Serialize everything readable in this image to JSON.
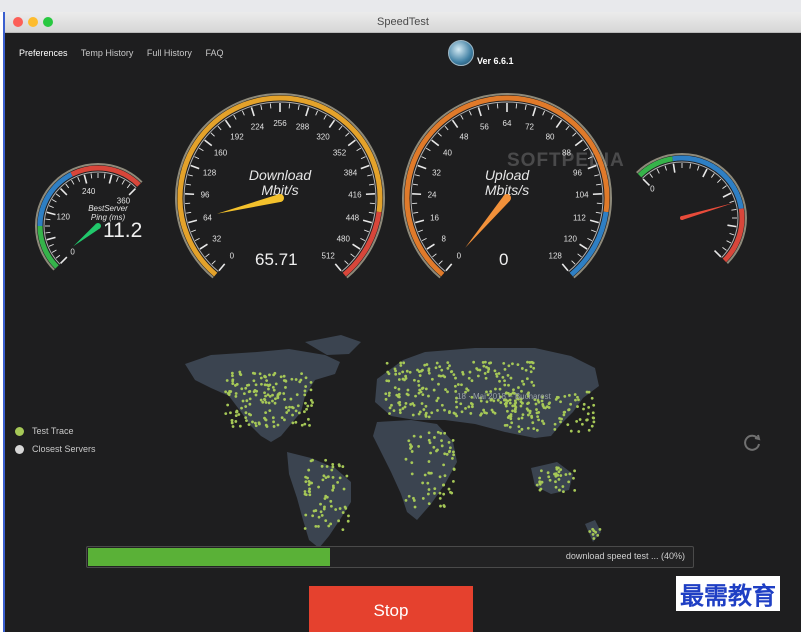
{
  "window": {
    "title": "SpeedTest"
  },
  "nav": [
    "Preferences",
    "Temp History",
    "Full History",
    "FAQ"
  ],
  "version": "Ver 6.6.1",
  "watermark_overlay": "SOFTPEDIA",
  "gauges": {
    "ping": {
      "label_line1": "BestServer",
      "label_line2": "Ping (ms)",
      "ticks": [
        "0",
        "120",
        "240",
        "360"
      ],
      "value": "11.2",
      "needle_value": 11.2,
      "max": 360
    },
    "download": {
      "label_line1": "Download",
      "label_line2": "Mbit/s",
      "ticks": [
        "0",
        "32",
        "64",
        "96",
        "128",
        "160",
        "192",
        "224",
        "256",
        "288",
        "320",
        "352",
        "384",
        "416",
        "448",
        "480",
        "512"
      ],
      "value": "65.71",
      "needle_value": 65.71,
      "max": 512
    },
    "upload": {
      "label_line1": "Upload",
      "label_line2": "Mbits/s",
      "ticks": [
        "0",
        "8",
        "16",
        "24",
        "32",
        "40",
        "48",
        "56",
        "64",
        "72",
        "80",
        "88",
        "96",
        "104",
        "112",
        "120",
        "128"
      ],
      "value": "0",
      "needle_value": 0,
      "max": 128
    },
    "extra": {
      "ticks": [
        "0"
      ],
      "needle_fraction": 0.66
    }
  },
  "map": {
    "trace_label": "18 · Mai 2018 – Bucharest"
  },
  "legend": [
    {
      "label": "Test Trace",
      "color": "#a6c857"
    },
    {
      "label": "Closest Servers",
      "color": "#d6d6d6"
    }
  ],
  "progress": {
    "text": "download speed test ... (40%)",
    "fraction": 0.4
  },
  "stop_label": "Stop",
  "corner_watermark": "最需教育",
  "colors": {
    "accent_green": "#5ab137",
    "stop_red": "#e5412e",
    "needle_yellow": "#f3c12c",
    "needle_orange": "#f2913a",
    "needle_green": "#21c86b",
    "needle_red": "#e84b3a"
  }
}
